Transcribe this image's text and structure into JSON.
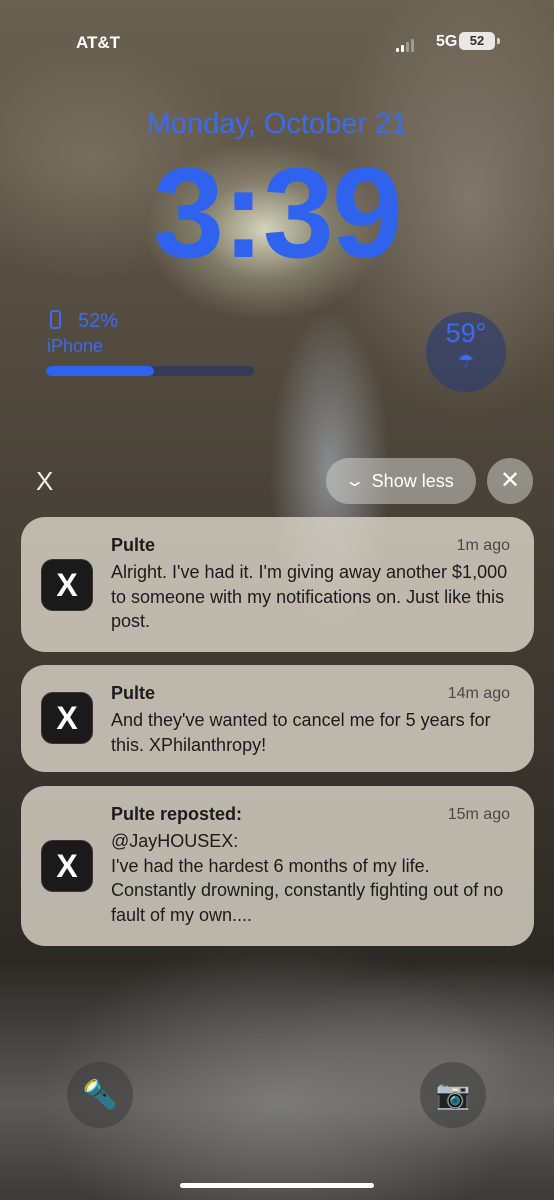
{
  "status_bar": {
    "carrier": "AT&T",
    "network": "5G",
    "battery_level": "52"
  },
  "lockscreen": {
    "date": "Monday, October 21",
    "time": "3:39",
    "accent_color": "#2f63ee"
  },
  "battery_widget": {
    "percent": "52%",
    "device": "iPhone",
    "level_fraction": 0.52
  },
  "weather_widget": {
    "temperature": "59°",
    "icon": "cloud-rain-icon"
  },
  "notification_group": {
    "app_icon_label": "X",
    "show_less_label": "Show less",
    "close_label": "✕"
  },
  "notifications": [
    {
      "app": "X",
      "title": "Pulte",
      "time": "1m ago",
      "body": "Alright. I've had it. I'm giving away another $1,000 to someone with my notifications on. Just like this post."
    },
    {
      "app": "X",
      "title": "Pulte",
      "time": "14m ago",
      "body": "And they've wanted to cancel me for 5 years for this. XPhilanthropy!"
    },
    {
      "app": "X",
      "title": "Pulte reposted:",
      "time": "15m ago",
      "body": "@JayHOUSEX:\nI've had the hardest 6 months of my life. Constantly drowning, constantly fighting out of no fault of my own...."
    }
  ],
  "bottom_controls": {
    "flashlight_icon": "flashlight-icon",
    "camera_icon": "camera-icon"
  }
}
